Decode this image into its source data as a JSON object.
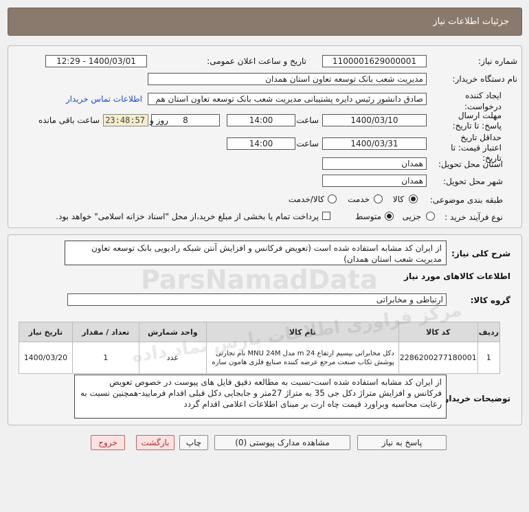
{
  "title": "جزئیات اطلاعات نیاز",
  "labels": {
    "need_number": "شماره نیاز:",
    "announce_datetime": "تاریخ و ساعت اعلان عمومی:",
    "buyer_org": "نام دستگاه خریدار:",
    "creator": "ایجاد کننده درخواست:",
    "reply_deadline": "مهلت ارسال پاسخ: تا تاریخ:",
    "time": "ساعت",
    "days_and": "روز و",
    "remaining": "ساعت باقی مانده",
    "price_validity": "حداقل تاریخ اعتبار قیمت: تا تاریخ:",
    "delivery_province": "استان محل تحویل:",
    "delivery_city": "شهر محل تحویل:",
    "subject_category": "طبقه بندی موضوعی:",
    "purchase_process": "نوع فرآیند خرید :",
    "summary": "شرح کلی نیاز:",
    "goods_info": "اطلاعات کالاهای مورد نیاز",
    "goods_group": "گروه کالا:",
    "buyer_notes": "توضیحات خریدار:"
  },
  "values": {
    "need_number": "1100001629000001",
    "announce_datetime": "1400/03/01 - 12:29",
    "buyer_org": "مدیریت شعب بانک توسعه تعاون استان همدان",
    "creator": "صادق دانشور رئیس دایره پشتیبانی مدیریت شعب بانک توسعه تعاون استان هم",
    "contact_link": "اطلاعات تماس خریدار",
    "reply_date": "1400/03/10",
    "reply_time": "14:00",
    "days": "8",
    "remaining_time": "23:48:57",
    "validity_date": "1400/03/31",
    "validity_time": "14:00",
    "province": "همدان",
    "city": "همدان",
    "goods_group": "ارتباطی و مخابراتی",
    "summary": "از ایران کد مشابه استفاده شده است (تعویض فرکانس و افزایش آنتن شبکه رادیویی بانک توسعه تعاون مدیریت شعب استان همدان)",
    "buyer_notes": "از ایران کد مشابه استفاده شده است-نسبت به مطالعه دقیق فایل های پیوست در خصوص تعویض فرکانس و افزایش متراژ دکل  جی 35 به متراژ 27متر و جابجایی دکل قبلی اقدام فرمایید-همچنین نسبت به رعایت محاسبه وبراورد قیمت چاه ارت بر مبنای اطلاعات اعلامی اقدام گردد"
  },
  "subject_options": [
    {
      "label": "کالا",
      "selected": true
    },
    {
      "label": "خدمت",
      "selected": false
    },
    {
      "label": "کالا/خدمت",
      "selected": false
    }
  ],
  "process_options": [
    {
      "label": "جزیی",
      "selected": false
    },
    {
      "label": "متوسط",
      "selected": true
    }
  ],
  "treasury_note": "پرداخت تمام یا بخشی از مبلغ خرید،از محل \"اسناد خزانه اسلامی\" خواهد بود.",
  "table": {
    "headers": [
      "ردیف",
      "کد کالا",
      "نام کالا",
      "واحد شمارش",
      "تعداد / مقدار",
      "تاریخ نیاز"
    ],
    "rows": [
      [
        "1",
        "2286200277180001",
        "دکل مخابراتی بیسیم ارتفاع 24 m مدل MNU 24M نام تجارتی پوشش تکاب صنعت مرجع عرضه کننده صنایع فلزی هامون سازه",
        "عدد",
        "1",
        "1400/03/20"
      ]
    ]
  },
  "buttons": {
    "reply": "پاسخ به نیاز",
    "attachments": "مشاهده مدارک پیوستی (0)",
    "print": "چاپ",
    "back": "بازگشت",
    "exit": "خروج"
  },
  "watermark": {
    "brand": "ParsNamadData",
    "persian": "مرکز فراوری اطلاعات پارس نماد داده"
  },
  "colors": {
    "titlebar": "#8a7a6e",
    "link": "#1a4fcf",
    "remaining_bg": "#f5edcc",
    "danger_button": "#fde2e2"
  }
}
